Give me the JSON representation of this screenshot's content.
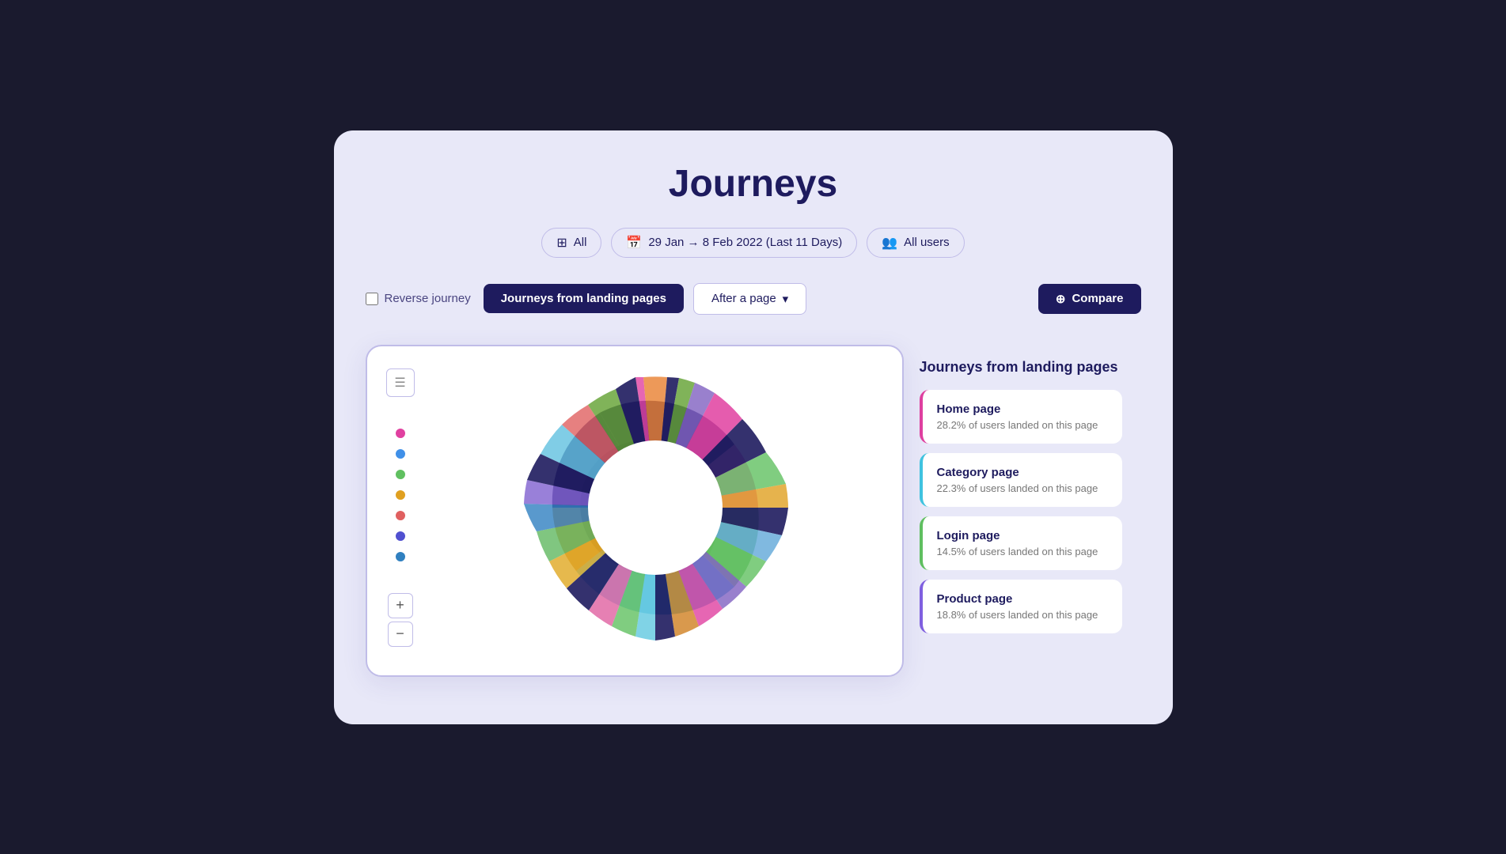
{
  "page": {
    "title": "Journeys",
    "filter_all": "All",
    "filter_date": "29 Jan → 8 Feb 2022 (Last 11 Days)",
    "filter_users": "All users",
    "reverse_journey": "Reverse journey",
    "tab_landing": "Journeys from landing pages",
    "tab_after": "After a page",
    "tab_after_chevron": "▾",
    "compare_btn": "Compare",
    "compare_icon": "⊕"
  },
  "right_panel": {
    "title": "Journeys from landing pages",
    "pages": [
      {
        "name": "Home page",
        "stat": "28.2% of users landed on this page",
        "color": "pink"
      },
      {
        "name": "Category page",
        "stat": "22.3% of users landed on this page",
        "color": "blue"
      },
      {
        "name": "Login page",
        "stat": "14.5% of users landed on this page",
        "color": "green"
      },
      {
        "name": "Product page",
        "stat": "18.8% of users landed on this page",
        "color": "purple"
      }
    ]
  },
  "legend": {
    "dots": [
      "#e040a0",
      "#4090e8",
      "#60c060",
      "#e0a020",
      "#e06060",
      "#5050d0",
      "#3080c0"
    ]
  },
  "icons": {
    "all_icon": "⊞",
    "date_icon": "📅",
    "users_icon": "👥",
    "list_icon": "☰",
    "zoom_in": "+",
    "zoom_out": "−"
  }
}
